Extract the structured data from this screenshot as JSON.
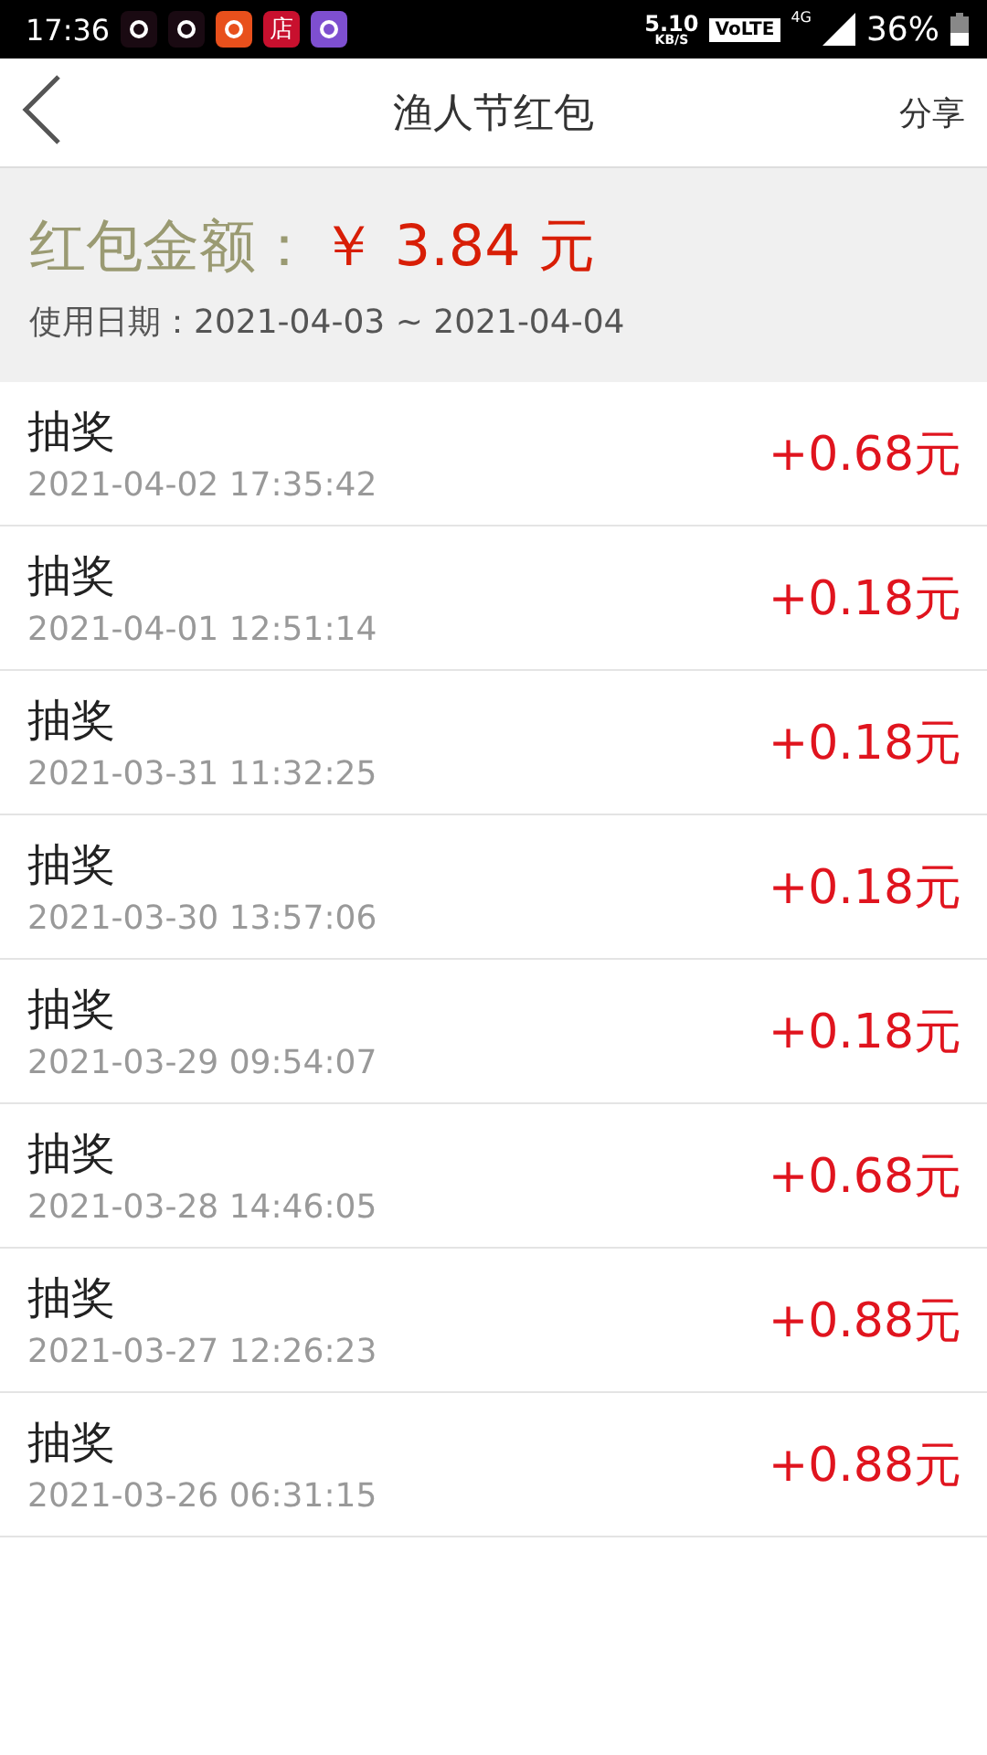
{
  "status_bar": {
    "time": "17:36",
    "app_icons": [
      {
        "color": "#1a0a12"
      },
      {
        "color": "#1a0a12"
      },
      {
        "color": "#e8501c"
      },
      {
        "color": "#c8102e",
        "glyph": "店"
      },
      {
        "color": "#7e4fd0"
      }
    ],
    "speed": "5.10",
    "speed_unit": "KB/S",
    "volte": "VoLTE",
    "network": "4G",
    "battery": "36%"
  },
  "header": {
    "title": "渔人节红包",
    "action": "分享"
  },
  "summary": {
    "amount_label": "红包金额：",
    "amount": "￥ 3.84 元",
    "date_label": "使用日期：2021-04-03 ~ 2021-04-04"
  },
  "records": [
    {
      "title": "抽奖",
      "time": "2021-04-02 17:35:42",
      "amount": "+0.68元"
    },
    {
      "title": "抽奖",
      "time": "2021-04-01 12:51:14",
      "amount": "+0.18元"
    },
    {
      "title": "抽奖",
      "time": "2021-03-31 11:32:25",
      "amount": "+0.18元"
    },
    {
      "title": "抽奖",
      "time": "2021-03-30 13:57:06",
      "amount": "+0.18元"
    },
    {
      "title": "抽奖",
      "time": "2021-03-29 09:54:07",
      "amount": "+0.18元"
    },
    {
      "title": "抽奖",
      "time": "2021-03-28 14:46:05",
      "amount": "+0.68元"
    },
    {
      "title": "抽奖",
      "time": "2021-03-27 12:26:23",
      "amount": "+0.88元"
    },
    {
      "title": "抽奖",
      "time": "2021-03-26 06:31:15",
      "amount": "+0.88元"
    }
  ]
}
